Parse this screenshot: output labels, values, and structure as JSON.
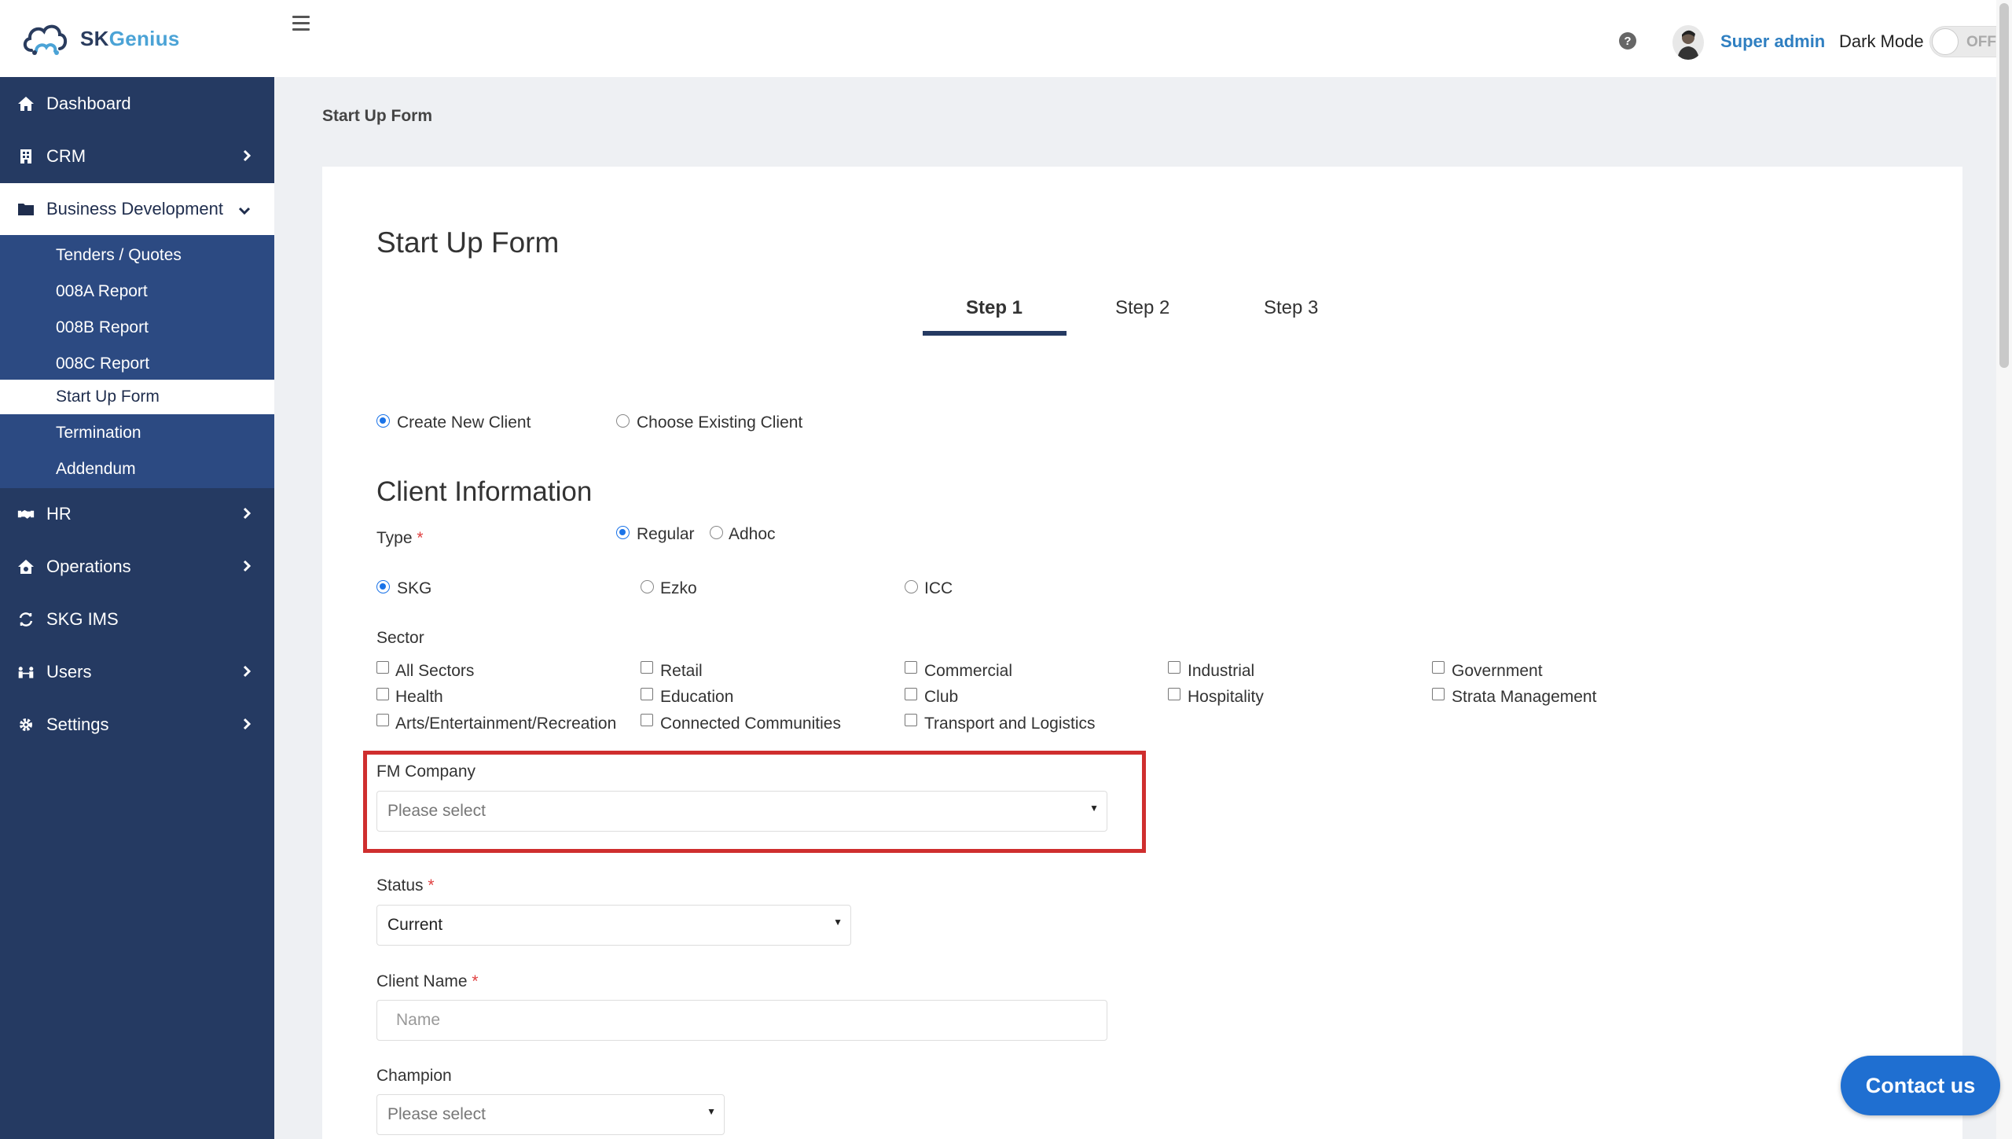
{
  "brand": {
    "name_part1": "SK",
    "name_part2": "Genius"
  },
  "sidebar": {
    "items": [
      {
        "label": "Dashboard",
        "icon": "home-icon"
      },
      {
        "label": "CRM",
        "icon": "building-icon"
      },
      {
        "label": "Business Development",
        "icon": "folder-icon"
      },
      {
        "label": "HR",
        "icon": "handshake-icon"
      },
      {
        "label": "Operations",
        "icon": "house-gear-icon"
      },
      {
        "label": "SKG IMS",
        "icon": "sync-icon"
      },
      {
        "label": "Users",
        "icon": "users-icon"
      },
      {
        "label": "Settings",
        "icon": "gear-icon"
      }
    ],
    "submenu": [
      "Tenders / Quotes",
      "008A Report",
      "008B Report",
      "008C Report",
      "Start Up Form",
      "Termination",
      "Addendum"
    ]
  },
  "topbar": {
    "user_name": "Super admin",
    "dark_mode_label": "Dark Mode",
    "toggle_text": "OFF"
  },
  "breadcrumb": "Start Up Form",
  "form": {
    "title": "Start Up Form",
    "steps": [
      "Step 1",
      "Step 2",
      "Step 3"
    ],
    "client_mode": {
      "options": [
        "Create New Client",
        "Choose Existing Client"
      ],
      "selected": "Create New Client"
    },
    "section_title": "Client Information",
    "type": {
      "label": "Type",
      "required_mark": "*",
      "options": [
        "Regular",
        "Adhoc"
      ],
      "selected": "Regular"
    },
    "company": {
      "options": [
        "SKG",
        "Ezko",
        "ICC"
      ],
      "selected": "SKG"
    },
    "sector": {
      "label": "Sector",
      "options": [
        "All Sectors",
        "Retail",
        "Commercial",
        "Industrial",
        "Government",
        "Health",
        "Education",
        "Club",
        "Hospitality",
        "Strata Management",
        "Arts/Entertainment/Recreation",
        "Connected Communities",
        "Transport and Logistics"
      ]
    },
    "fm_company": {
      "label": "FM Company",
      "value": "Please select"
    },
    "status": {
      "label": "Status",
      "required_mark": "*",
      "value": "Current"
    },
    "client_name": {
      "label": "Client Name",
      "required_mark": "*",
      "placeholder": "Name"
    },
    "champion": {
      "label": "Champion",
      "value": "Please select"
    }
  },
  "contact_button": "Contact us",
  "colors": {
    "sidebar": "#253a62",
    "submenu": "#2c4a82",
    "accent": "#1f6fd1",
    "highlight": "#cf2e2e",
    "brand_blue": "#4ba3d6"
  }
}
